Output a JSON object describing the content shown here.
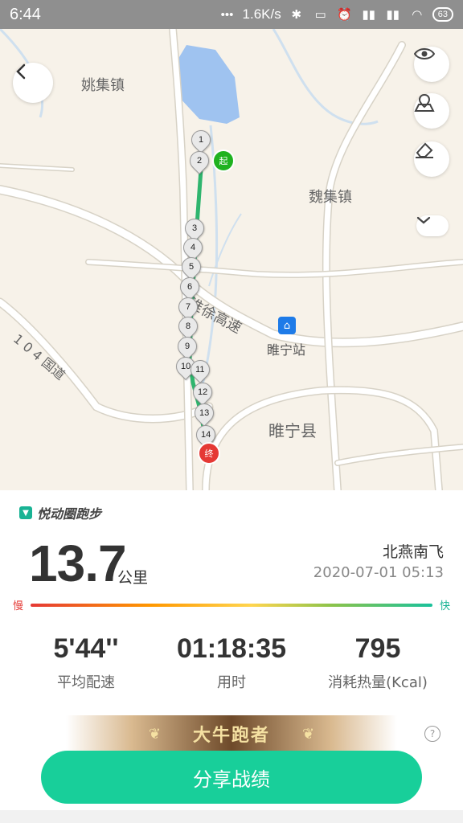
{
  "status_bar": {
    "time": "6:44",
    "speed": "1.6K/s",
    "battery": "63",
    "icons": [
      "dots-icon",
      "bluetooth-icon",
      "vibrate-icon",
      "alarm-icon",
      "signal-hd-icon",
      "signal-hd-icon",
      "wifi-icon",
      "battery-icon"
    ]
  },
  "map": {
    "labels": {
      "yaoji": "姚集镇",
      "weiji": "魏集镇",
      "highway": "淮徐高速",
      "route104": "1 0 4 国道",
      "station": "睢宁站",
      "county": "睢宁县"
    },
    "markers": [
      "1",
      "2",
      "3",
      "4",
      "5",
      "6",
      "7",
      "8",
      "9",
      "10",
      "11",
      "12",
      "13",
      "14"
    ],
    "start_label": "起",
    "end_label": "终",
    "controls": [
      "back-icon",
      "eye-icon",
      "map-pin-icon",
      "eraser-icon",
      "chevron-down-icon"
    ],
    "colors": {
      "route": "#2fb56e",
      "water": "#9fc3f0",
      "road": "#ffffff",
      "minor_road": "#cfe0ef"
    }
  },
  "summary": {
    "brand": "悦动圈跑步",
    "distance": "13.7",
    "distance_unit": "公里",
    "user": "北燕南飞",
    "datetime": "2020-07-01 05:13",
    "slow_label": "慢",
    "fast_label": "快"
  },
  "stats": [
    {
      "value": "5'44''",
      "label": "平均配速"
    },
    {
      "value": "01:18:35",
      "label": "用时"
    },
    {
      "value": "795",
      "label": "消耗热量(Kcal)"
    }
  ],
  "badge": {
    "text": "大牛跑者"
  },
  "share_button": "分享战绩",
  "accent": "#18cf9a"
}
